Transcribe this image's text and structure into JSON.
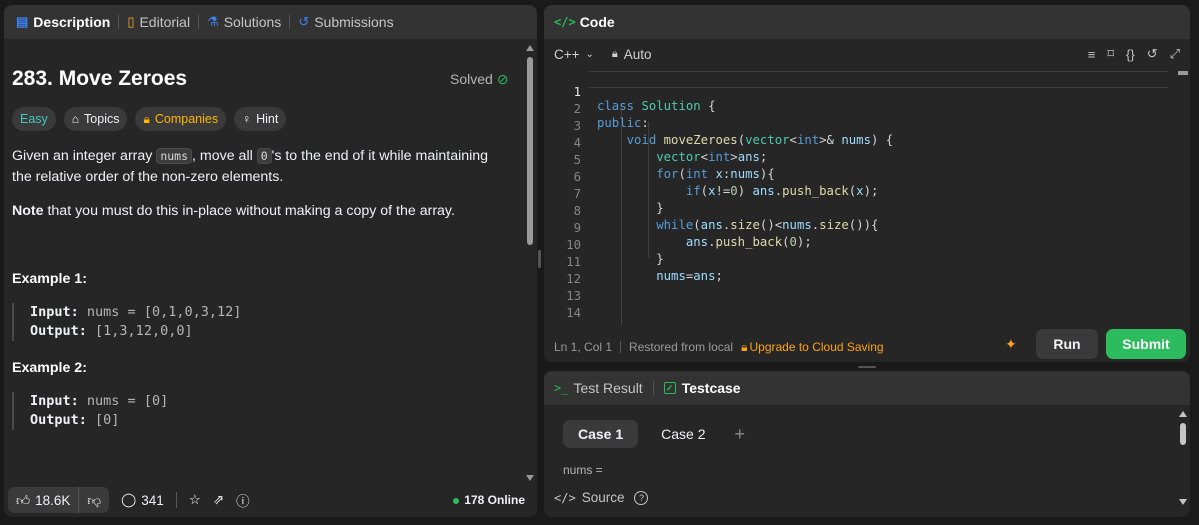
{
  "tabs": [
    {
      "label": "Description",
      "icon": "description-icon"
    },
    {
      "label": "Editorial",
      "icon": "book-icon"
    },
    {
      "label": "Solutions",
      "icon": "flask-icon"
    },
    {
      "label": "Submissions",
      "icon": "history-icon"
    }
  ],
  "problem": {
    "title": "283. Move Zeroes",
    "status": "Solved",
    "tags": {
      "difficulty": "Easy",
      "topics": "Topics",
      "companies": "Companies",
      "hint": "Hint"
    },
    "desc_a": "Given an integer array ",
    "desc_code1": "nums",
    "desc_b": ", move all ",
    "desc_code2": "0",
    "desc_c": "'s to the end of it while maintaining the relative order of the non-zero elements.",
    "note_bold": "Note",
    "note_rest": " that you must do this in-place without making a copy of the array.",
    "examples": [
      {
        "title": "Example 1:",
        "input_label": "Input:",
        "input": "nums = [0,1,0,3,12]",
        "output_label": "Output:",
        "output": "[1,3,12,0,0]"
      },
      {
        "title": "Example 2:",
        "input_label": "Input:",
        "input": "nums = [0]",
        "output_label": "Output:",
        "output": "[0]"
      }
    ]
  },
  "footer": {
    "likes": "18.6K",
    "comments": "341",
    "online": "178 Online"
  },
  "code": {
    "header": "Code",
    "language": "C++",
    "mode": "Auto",
    "line_numbers": [
      "1",
      "2",
      "3",
      "4",
      "5",
      "6",
      "7",
      "8",
      "9",
      "10",
      "11",
      "12",
      "13",
      "14"
    ],
    "cursor": "Ln 1, Col 1",
    "restored": "Restored from local",
    "upgrade": "Upgrade to Cloud Saving",
    "run": "Run",
    "submit": "Submit"
  },
  "test": {
    "result_tab": "Test Result",
    "testcase_tab": "Testcase",
    "cases": [
      "Case 1",
      "Case 2"
    ],
    "param": "nums =",
    "source": "Source"
  },
  "colors": {
    "accent_green": "#2cbb5d",
    "accent_orange": "#ffa116",
    "easy": "#46c6c2"
  }
}
